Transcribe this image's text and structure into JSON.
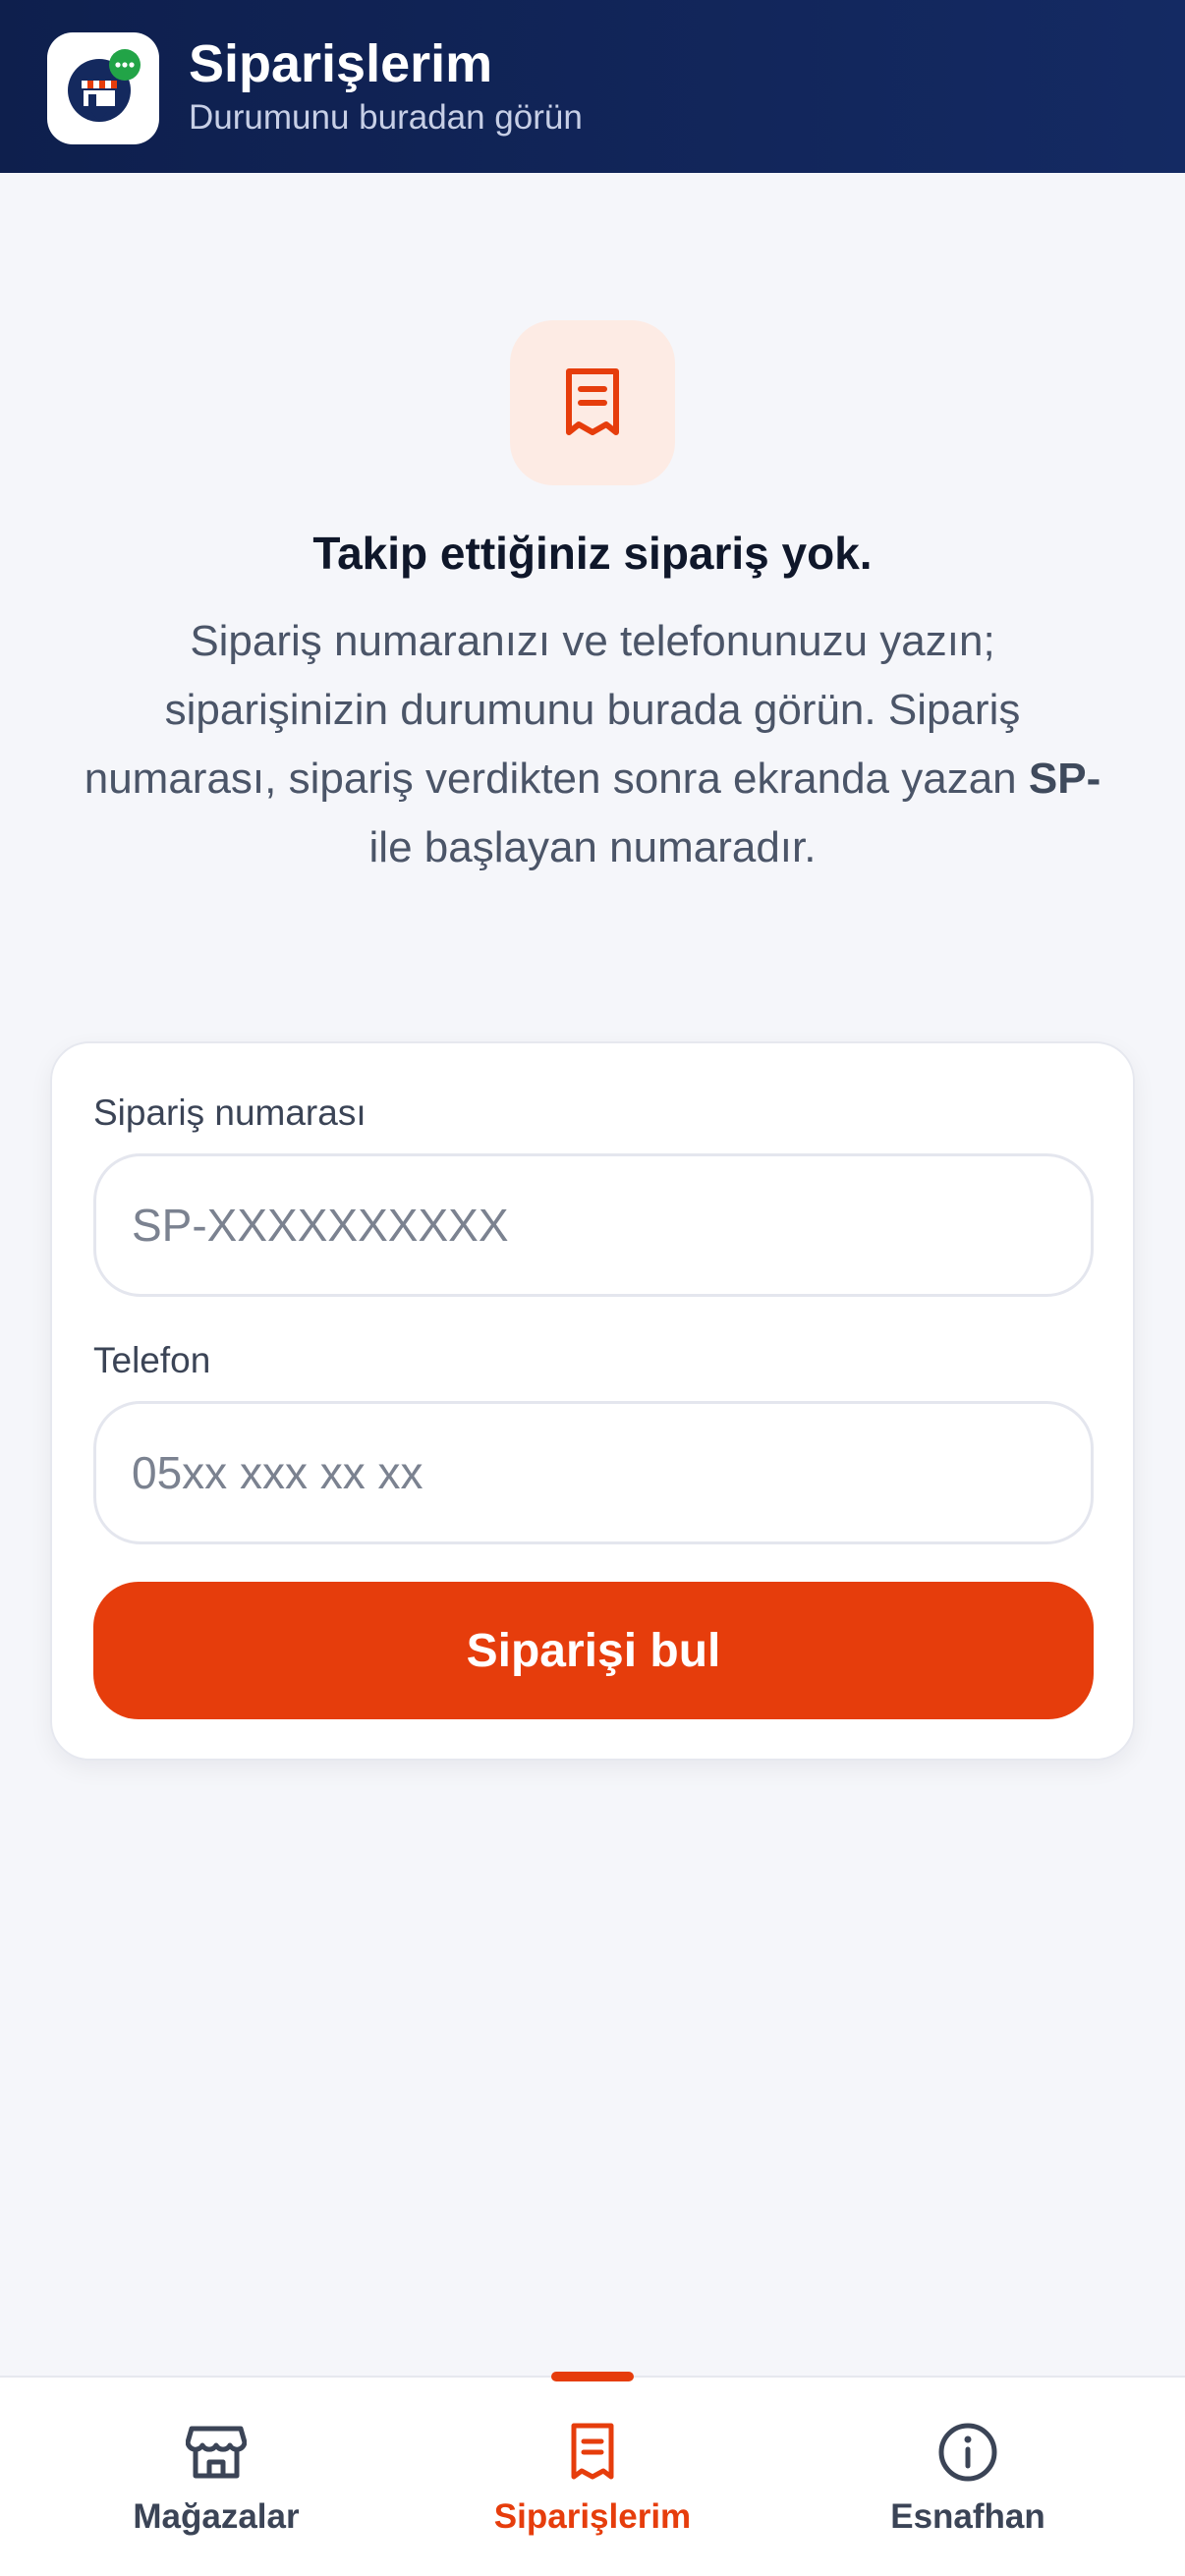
{
  "header": {
    "title": "Siparişlerim",
    "subtitle": "Durumunu buradan görün",
    "logo_icon": "store-scooter-chat-logo"
  },
  "empty_state": {
    "icon": "receipt-icon",
    "title": "Takip ettiğiniz sipariş yok.",
    "description_before": "Sipariş numaranızı ve telefonunuzu yazın; siparişinizin durumunu burada görün. Sipariş numarası, sipariş verdikten sonra ekranda yazan ",
    "description_bold": "SP-",
    "description_after": " ile başlayan numaradır."
  },
  "form": {
    "order_label": "Sipariş numarası",
    "order_placeholder": "SP-XXXXXXXXXX",
    "order_value": "",
    "phone_label": "Telefon",
    "phone_placeholder": "05xx xxx xx xx",
    "phone_value": "",
    "submit_label": "Siparişi bul"
  },
  "nav": {
    "items": [
      {
        "label": "Mağazalar",
        "icon": "store-icon",
        "active": false
      },
      {
        "label": "Siparişlerim",
        "icon": "receipt-icon",
        "active": true
      },
      {
        "label": "Esnafhan",
        "icon": "info-icon",
        "active": false
      }
    ]
  },
  "colors": {
    "accent": "#e63d0c",
    "header_bg": "#0e1f4d",
    "page_bg": "#f5f6fa",
    "icon_tint_bg": "#fdebe4"
  }
}
